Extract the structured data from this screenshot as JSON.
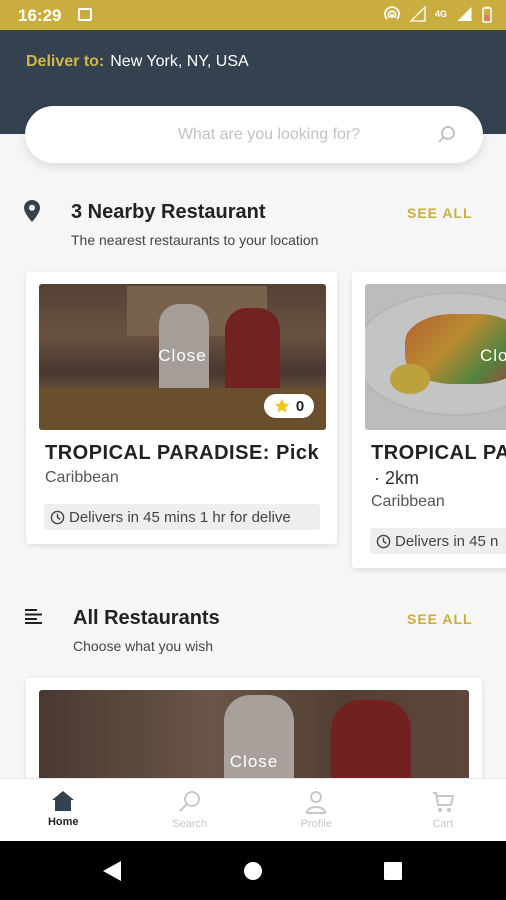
{
  "status_bar": {
    "time": "16:29",
    "network": "4G"
  },
  "header": {
    "deliver_label": "Deliver to:",
    "deliver_value": "New York, NY, USA"
  },
  "search": {
    "placeholder": "What are you looking for?"
  },
  "nearby": {
    "title": "3 Nearby Restaurant",
    "subtitle": "The nearest restaurants to your location",
    "see_all": "SEE ALL",
    "cards": [
      {
        "status": "Close",
        "rating": "0",
        "title": "TROPICAL PARADISE: Pick",
        "cuisine": "Caribbean",
        "delivery": "Delivers in 45 mins 1 hr for delive"
      },
      {
        "status": "Clo",
        "title": "TROPICAL PA",
        "distance": "· 2km",
        "cuisine": "Caribbean",
        "delivery": "Delivers in 45 n"
      }
    ]
  },
  "all": {
    "title": "All Restaurants",
    "subtitle": "Choose what you wish",
    "see_all": "SEE ALL",
    "card": {
      "status": "Close"
    }
  },
  "bottom_nav": [
    {
      "label": "Home",
      "icon": "home-icon",
      "active": true
    },
    {
      "label": "Search",
      "icon": "search-icon",
      "active": false
    },
    {
      "label": "Profile",
      "icon": "profile-icon",
      "active": false
    },
    {
      "label": "Cart",
      "icon": "cart-icon",
      "active": false
    }
  ],
  "colors": {
    "accent": "#c9ae3f",
    "header": "#34414f"
  }
}
